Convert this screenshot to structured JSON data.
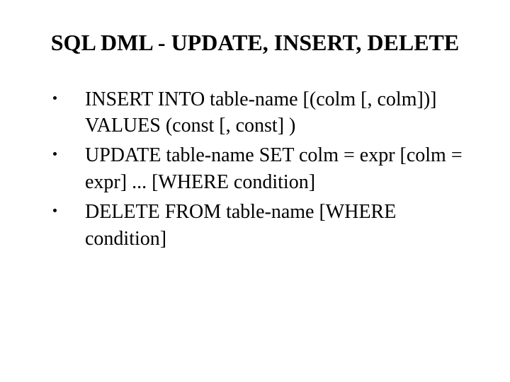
{
  "title": "SQL DML - UPDATE, INSERT, DELETE",
  "bullets": [
    "INSERT INTO table-name [(colm [, colm])] VALUES (const [, const] )",
    "UPDATE table-name SET colm = expr [colm = expr] ... [WHERE condition]",
    "DELETE FROM table-name [WHERE condition]"
  ]
}
